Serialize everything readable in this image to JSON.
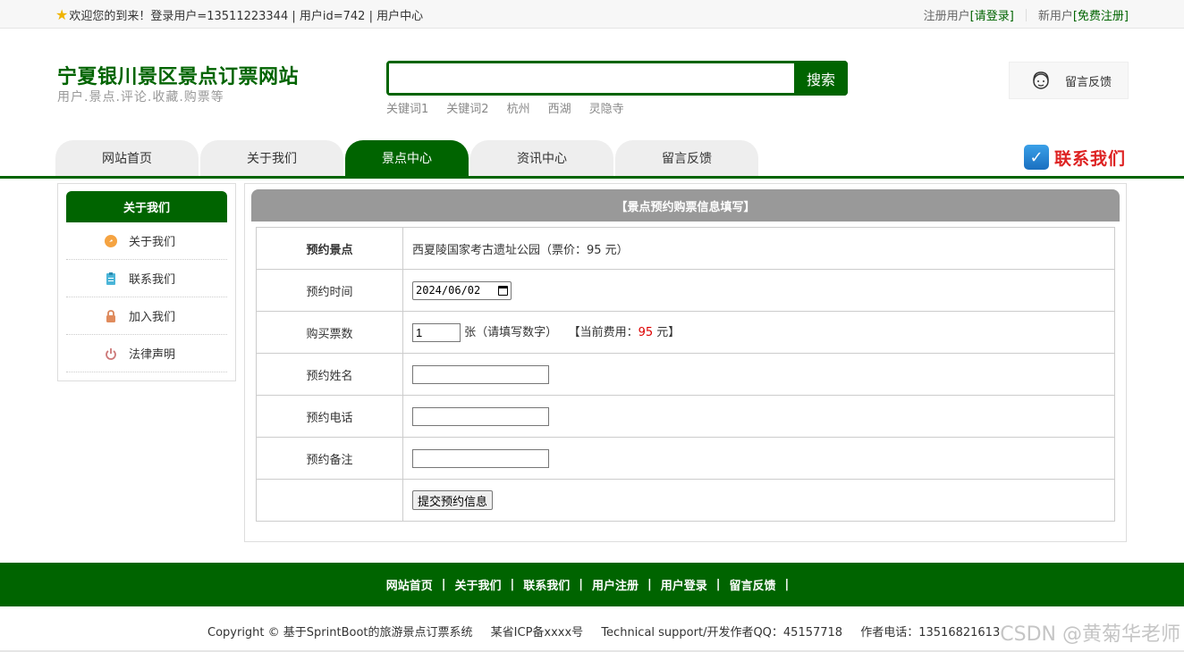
{
  "topbar": {
    "welcome": "欢迎您的到来！登录用户=13511223344 | 用户id=742 | 用户中心",
    "register_prefix": "注册用户",
    "register_link": "[请登录]",
    "newuser_prefix": "新用户",
    "newuser_link": "[免费注册]"
  },
  "header": {
    "title": "宁夏银川景区景点订票网站",
    "subtitle": "用户.景点.评论.收藏.购票等",
    "search_placeholder": "",
    "search_button": "搜索",
    "keywords": [
      "关键词1",
      "关键词2",
      "杭州",
      "西湖",
      "灵隐寺"
    ],
    "feedback": "留言反馈"
  },
  "nav": {
    "items": [
      "网站首页",
      "关于我们",
      "景点中心",
      "资讯中心",
      "留言反馈"
    ],
    "active_index": 2,
    "contact": "联系我们"
  },
  "sidebar": {
    "title": "关于我们",
    "items": [
      {
        "label": "关于我们",
        "icon": "orange-circle-icon"
      },
      {
        "label": "联系我们",
        "icon": "clipboard-icon"
      },
      {
        "label": "加入我们",
        "icon": "lock-icon"
      },
      {
        "label": "法律声明",
        "icon": "power-icon"
      }
    ]
  },
  "form": {
    "title": "【景点预约购票信息填写】",
    "rows": {
      "spot_label": "预约景点",
      "spot_value": "西夏陵国家考古遗址公园（票价：95 元）",
      "time_label": "预约时间",
      "time_value": "2024/06/02",
      "count_label": "购买票数",
      "count_value": "1",
      "count_hint": "张（请填写数字）",
      "fee_prefix": "【当前费用：",
      "fee_value": "95",
      "fee_suffix": " 元】",
      "name_label": "预约姓名",
      "phone_label": "预约电话",
      "remark_label": "预约备注",
      "submit": "提交预约信息"
    }
  },
  "footer": {
    "links": [
      "网站首页",
      "关于我们",
      "联系我们",
      "用户注册",
      "用户登录",
      "留言反馈"
    ],
    "copyright": "Copyright © 基于SprintBoot的旅游景点订票系统",
    "icp": "某省ICP备xxxx号",
    "support": "Technical support/开发作者QQ：45157718",
    "phone": "作者电话：13516821613",
    "watermark": "CSDN @黄菊华老师"
  },
  "colors": {
    "brand_green": "#006400",
    "header_gray": "#999999",
    "fee_red": "#dd0000"
  }
}
